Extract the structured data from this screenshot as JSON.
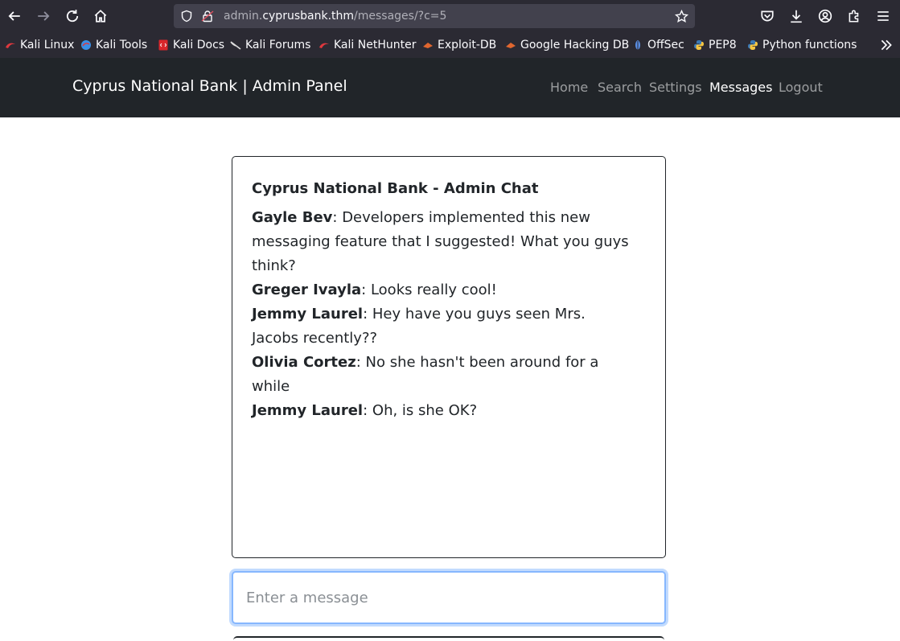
{
  "browser": {
    "url_prefix": "admin.",
    "url_host": "cyprusbank.thm",
    "url_path": "/messages/?c=5",
    "icons": [
      "back-icon",
      "forward-icon",
      "reload-icon",
      "home-icon",
      "shield-icon",
      "lock-icon",
      "star-icon",
      "pocket-icon",
      "download-icon",
      "account-icon",
      "extensions-icon",
      "menu-icon",
      "overflow-chevrons-icon"
    ]
  },
  "bookmarks": [
    {
      "label": "Kali Linux",
      "icon": "kali-icon",
      "color": "#e0383e"
    },
    {
      "label": "Kali Tools",
      "icon": "kali-tools-icon",
      "color": "#3a8ee6"
    },
    {
      "label": "Kali Docs",
      "icon": "kali-docs-icon",
      "color": "#d8262b"
    },
    {
      "label": "Kali Forums",
      "icon": "kali-forums-icon",
      "color": "#cfcfcf"
    },
    {
      "label": "Kali NetHunter",
      "icon": "nethunter-icon",
      "color": "#e0383e"
    },
    {
      "label": "Exploit-DB",
      "icon": "exploit-db-icon",
      "color": "#e0662f"
    },
    {
      "label": "Google Hacking DB",
      "icon": "ghdb-icon",
      "color": "#e0662f"
    },
    {
      "label": "OffSec",
      "icon": "offsec-icon",
      "color": "#5a8fe6"
    },
    {
      "label": "PEP8",
      "icon": "python-icon",
      "color": "#f5c542"
    },
    {
      "label": "Python functions",
      "icon": "python-icon",
      "color": "#f5c542"
    }
  ],
  "navbar": {
    "brand": "Cyprus National Bank | Admin Panel",
    "links": [
      "Home",
      "Search",
      "Settings",
      "Messages",
      "Logout"
    ],
    "active": "Messages"
  },
  "chat": {
    "title": "Cyprus National Bank - Admin Chat",
    "messages": [
      {
        "author": "Gayle Bev",
        "text": ": Developers implemented this new messaging feature that I suggested! What you guys think?"
      },
      {
        "author": "Greger Ivayla",
        "text": ": Looks really cool!"
      },
      {
        "author": "Jemmy Laurel",
        "text": ": Hey have you guys seen Mrs. Jacobs recently??"
      },
      {
        "author": "Olivia Cortez",
        "text": ": No she hasn't been around for a while"
      },
      {
        "author": "Jemmy Laurel",
        "text": ": Oh, is she OK?"
      }
    ],
    "input_placeholder": "Enter a message",
    "input_value": ""
  }
}
